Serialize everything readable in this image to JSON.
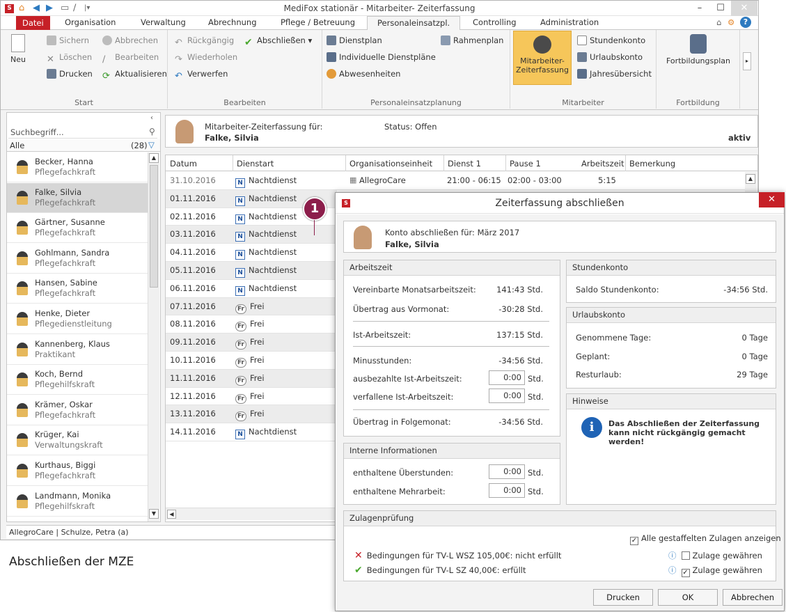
{
  "window": {
    "title": "MediFox stationär - Mitarbeiter- Zeiterfassung"
  },
  "tabs": [
    {
      "label": "Datei"
    },
    {
      "label": "Organisation"
    },
    {
      "label": "Verwaltung"
    },
    {
      "label": "Abrechnung"
    },
    {
      "label": "Pflege / Betreuung"
    },
    {
      "label": "Personaleinsatzpl."
    },
    {
      "label": "Controlling"
    },
    {
      "label": "Administration"
    }
  ],
  "ribbon": {
    "start": {
      "label": "Start",
      "neu": "Neu",
      "sichern": "Sichern",
      "abbrechen": "Abbrechen",
      "loeschen": "Löschen",
      "bearbeiten": "Bearbeiten",
      "drucken": "Drucken",
      "aktualisieren": "Aktualisieren"
    },
    "bearbeiten": {
      "label": "Bearbeiten",
      "rueckgaengig": "Rückgängig",
      "abschliessen": "Abschließen",
      "wiederholen": "Wiederholen",
      "verwerfen": "Verwerfen"
    },
    "pep": {
      "label": "Personaleinsatzplanung",
      "dienstplan": "Dienstplan",
      "rahmenplan": "Rahmenplan",
      "individuelle": "Individuelle Dienstpläne",
      "abwesenheiten": "Abwesenheiten"
    },
    "mitarbeiter": {
      "label": "Mitarbeiter",
      "mze1": "Mitarbeiter-",
      "mze2": "Zeiterfassung",
      "stundenkonto": "Stundenkonto",
      "urlaubskonto": "Urlaubskonto",
      "jahresuebersicht": "Jahresübersicht"
    },
    "fortbildung": {
      "label": "Fortbildung",
      "plan": "Fortbildungsplan"
    }
  },
  "left": {
    "search_placeholder": "Suchbegriff...",
    "filter": "Alle",
    "count": "(28)",
    "employees": [
      {
        "name": "Becker, Hanna",
        "role": "Pflegefachkraft"
      },
      {
        "name": "Falke, Silvia",
        "role": "Pflegefachkraft"
      },
      {
        "name": "Gärtner, Susanne",
        "role": "Pflegefachkraft"
      },
      {
        "name": "Gohlmann, Sandra",
        "role": "Pflegefachkraft"
      },
      {
        "name": "Hansen, Sabine",
        "role": "Pflegefachkraft"
      },
      {
        "name": "Henke, Dieter",
        "role": "Pflegedienstleitung"
      },
      {
        "name": "Kannenberg, Klaus",
        "role": "Praktikant"
      },
      {
        "name": "Koch, Bernd",
        "role": "Pflegehilfskraft"
      },
      {
        "name": "Krämer, Oskar",
        "role": "Pflegefachkraft"
      },
      {
        "name": "Krüger, Kai",
        "role": "Verwaltungskraft"
      },
      {
        "name": "Kurthaus, Biggi",
        "role": "Pflegefachkraft"
      },
      {
        "name": "Landmann, Monika",
        "role": "Pflegehilfskraft"
      }
    ]
  },
  "status_bar": "AllegroCare | Schulze, Petra (a)",
  "main": {
    "header_label": "Mitarbeiter-Zeiterfassung für:",
    "header_name": "Falke, Silvia",
    "status": "Status: Offen",
    "aktiv": "aktiv",
    "columns": [
      "Datum",
      "Dienstart",
      "Organisationseinheit",
      "Dienst 1",
      "Pause 1",
      "Arbeitszeit",
      "Bemerkung"
    ],
    "first_row": {
      "org": "AllegroCare",
      "dienst1": "21:00 - 06:15",
      "pause1": "02:00 - 03:00",
      "arbeitszeit": "5:15"
    },
    "rows": [
      {
        "date": "31.10.2016",
        "code": "N",
        "type": "Nachtdienst"
      },
      {
        "date": "01.11.2016",
        "code": "N",
        "type": "Nachtdienst"
      },
      {
        "date": "02.11.2016",
        "code": "N",
        "type": "Nachtdienst"
      },
      {
        "date": "03.11.2016",
        "code": "N",
        "type": "Nachtdienst"
      },
      {
        "date": "04.11.2016",
        "code": "N",
        "type": "Nachtdienst"
      },
      {
        "date": "05.11.2016",
        "code": "N",
        "type": "Nachtdienst"
      },
      {
        "date": "06.11.2016",
        "code": "N",
        "type": "Nachtdienst"
      },
      {
        "date": "07.11.2016",
        "code": "Fr",
        "type": "Frei"
      },
      {
        "date": "08.11.2016",
        "code": "Fr",
        "type": "Frei"
      },
      {
        "date": "09.11.2016",
        "code": "Fr",
        "type": "Frei"
      },
      {
        "date": "10.11.2016",
        "code": "Fr",
        "type": "Frei"
      },
      {
        "date": "11.11.2016",
        "code": "Fr",
        "type": "Frei"
      },
      {
        "date": "12.11.2016",
        "code": "Fr",
        "type": "Frei"
      },
      {
        "date": "13.11.2016",
        "code": "Fr",
        "type": "Frei"
      },
      {
        "date": "14.11.2016",
        "code": "N",
        "type": "Nachtdienst"
      }
    ]
  },
  "callout": "1",
  "caption": "Abschließen der MZE",
  "dialog": {
    "title": "Zeiterfassung abschließen",
    "account_label": "Konto abschließen für: März 2017",
    "account_name": "Falke, Silvia",
    "arbeitszeit": {
      "header": "Arbeitszeit",
      "vereinbarte_label": "Vereinbarte Monatsarbeitszeit:",
      "vereinbarte_value": "141:43 Std.",
      "uebertrag_vor_label": "Übertrag aus Vormonat:",
      "uebertrag_vor_value": "-30:28 Std.",
      "ist_label": "Ist-Arbeitszeit:",
      "ist_value": "137:15 Std.",
      "minus_label": "Minusstunden:",
      "minus_value": "-34:56 Std.",
      "ausbezahlt_label": "ausbezahlte Ist-Arbeitszeit:",
      "ausbezahlt_value": "0:00",
      "verfallen_label": "verfallene Ist-Arbeitszeit:",
      "verfallen_value": "0:00",
      "unit": "Std.",
      "uebertrag_folge_label": "Übertrag in Folgemonat:",
      "uebertrag_folge_value": "-34:56 Std."
    },
    "interne": {
      "header": "Interne Informationen",
      "ueberstunden_label": "enthaltene Überstunden:",
      "ueberstunden_value": "0:00",
      "mehrarbeit_label": "enthaltene Mehrarbeit:",
      "mehrarbeit_value": "0:00",
      "unit": "Std."
    },
    "stundenkonto": {
      "header": "Stundenkonto",
      "saldo_label": "Saldo Stundenkonto:",
      "saldo_value": "-34:56 Std."
    },
    "urlaubskonto": {
      "header": "Urlaubskonto",
      "genommen_label": "Genommene Tage:",
      "genommen_value": "0 Tage",
      "geplant_label": "Geplant:",
      "geplant_value": "0 Tage",
      "rest_label": "Resturlaub:",
      "rest_value": "29 Tage"
    },
    "hinweise": {
      "header": "Hinweise",
      "text": "Das Abschließen der Zeiterfassung kann nicht rückgängig gemacht werden!"
    },
    "zulagen": {
      "header": "Zulagenprüfung",
      "show_all": "Alle gestaffelten Zulagen anzeigen",
      "cond1": "Bedingungen für TV-L WSZ 105,00€: nicht erfüllt",
      "cond2": "Bedingungen für TV-L SZ 40,00€: erfüllt",
      "gewaehren": "Zulage gewähren"
    },
    "buttons": {
      "drucken": "Drucken",
      "ok": "OK",
      "abbrechen": "Abbrechen"
    }
  }
}
